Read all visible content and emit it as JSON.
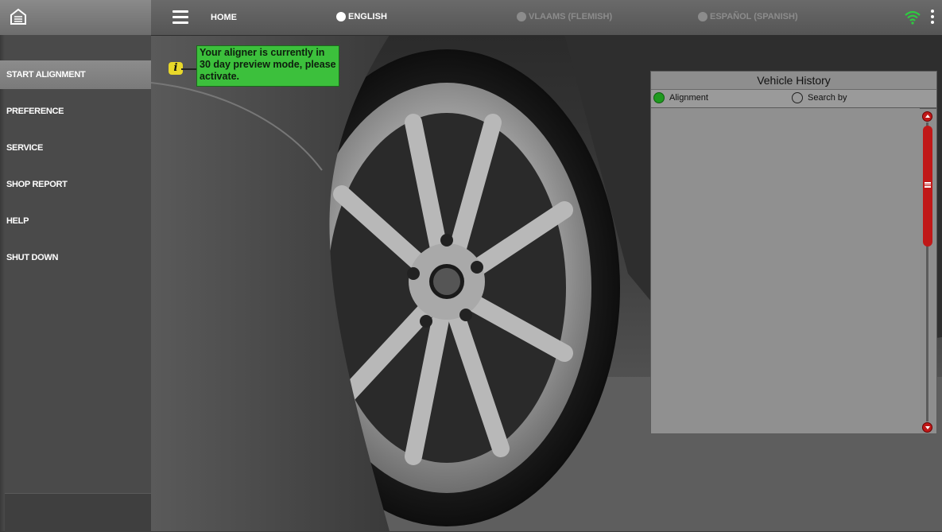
{
  "topbar": {
    "home_label": "HOME",
    "languages": [
      {
        "label": "ENGLISH",
        "selected": true
      },
      {
        "label": "VLAAMS (FLEMISH)",
        "selected": false
      },
      {
        "label": "ESPAÑOL (SPANISH)",
        "selected": false
      }
    ],
    "icons": {
      "logo": "garage-icon",
      "menu": "hamburger-menu-icon",
      "wifi": "wifi-icon",
      "more": "more-vertical-icon"
    },
    "wifi_color": "#2ecc40"
  },
  "sidebar": {
    "items": [
      {
        "label": "START ALIGNMENT",
        "active": true
      },
      {
        "label": "PREFERENCE",
        "active": false
      },
      {
        "label": "SERVICE",
        "active": false
      },
      {
        "label": "SHOP REPORT",
        "active": false
      },
      {
        "label": "HELP",
        "active": false
      },
      {
        "label": "SHUT DOWN",
        "active": false
      }
    ]
  },
  "notice": {
    "icon": "info-icon",
    "text": "Your aligner is currently in 30 day preview mode, please activate.",
    "color": "#3cc03c"
  },
  "vehicle_history": {
    "title": "Vehicle History",
    "tabs": [
      {
        "label": "Alignment",
        "selected": true
      },
      {
        "label": "Search by",
        "selected": false
      }
    ],
    "scrollbar_color": "#c01818",
    "items": []
  }
}
